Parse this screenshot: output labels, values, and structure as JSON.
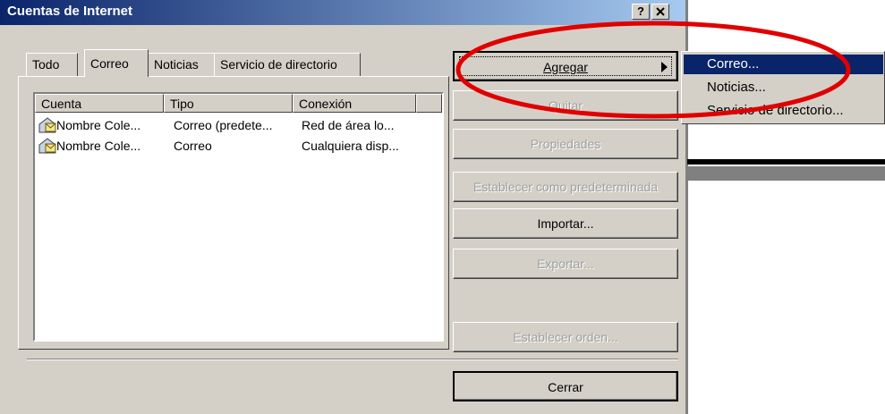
{
  "window": {
    "title": "Cuentas de Internet",
    "help_button": "?",
    "close_button": "×"
  },
  "tabs": [
    {
      "label": "Todo",
      "selected": false
    },
    {
      "label": "Correo",
      "selected": true
    },
    {
      "label": "Noticias",
      "selected": false
    },
    {
      "label": "Servicio de directorio",
      "selected": false
    }
  ],
  "list": {
    "columns": [
      "Cuenta",
      "Tipo",
      "Conexión"
    ],
    "rows": [
      {
        "cuenta": "Nombre Cole...",
        "tipo": "Correo (predete...",
        "conexion": "Red de área lo...",
        "icon": "mail-account-icon"
      },
      {
        "cuenta": "Nombre Cole...",
        "tipo": "Correo",
        "conexion": "Cualquiera disp...",
        "icon": "mail-account-icon"
      }
    ]
  },
  "buttons": {
    "agregar": "Agregar",
    "quitar": "Quitar",
    "propiedades": "Propiedades",
    "establecer_predeterminada": "Establecer como predeterminada",
    "importar": "Importar...",
    "exportar": "Exportar...",
    "establecer_orden": "Establecer orden...",
    "cerrar": "Cerrar"
  },
  "menu": {
    "items": [
      "Correo...",
      "Noticias...",
      "Servicio de directorio..."
    ],
    "highlighted_index": 0
  },
  "colors": {
    "titlebar": "#0a246a",
    "highlight": "#0a246a",
    "annotation_ring": "#e00000"
  }
}
